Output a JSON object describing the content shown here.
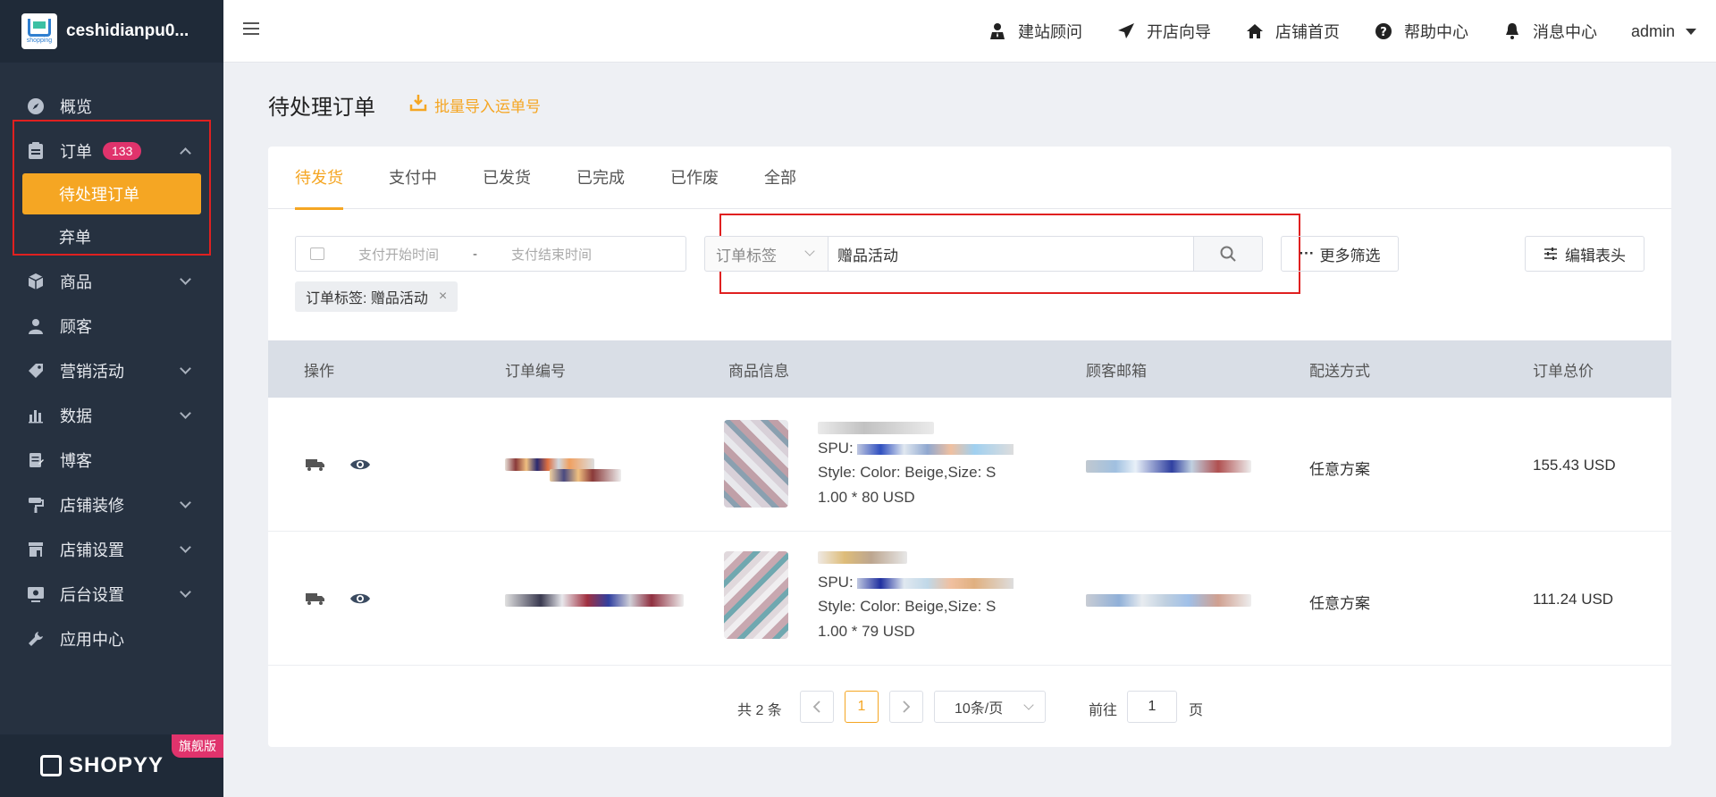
{
  "brand": {
    "name": "ceshidianpu0...",
    "logo_text": "shopping"
  },
  "sidebar": {
    "items": [
      {
        "label": "概览",
        "icon": "compass-icon"
      },
      {
        "label": "订单",
        "icon": "clipboard-icon",
        "badge": "133",
        "expanded": true,
        "children": [
          {
            "label": "待处理订单",
            "active": true
          },
          {
            "label": "弃单"
          }
        ]
      },
      {
        "label": "商品",
        "icon": "cube-icon"
      },
      {
        "label": "顾客",
        "icon": "user-icon"
      },
      {
        "label": "营销活动",
        "icon": "tag-icon"
      },
      {
        "label": "数据",
        "icon": "bar-chart-icon"
      },
      {
        "label": "博客",
        "icon": "blog-icon"
      },
      {
        "label": "店铺装修",
        "icon": "paint-roller-icon"
      },
      {
        "label": "店铺设置",
        "icon": "store-icon"
      },
      {
        "label": "后台设置",
        "icon": "admin-settings-icon"
      },
      {
        "label": "应用中心",
        "icon": "wrench-icon"
      }
    ],
    "footer": {
      "logo": "SHOPYY",
      "edition": "旗舰版"
    }
  },
  "header": {
    "nav": [
      {
        "label": "建站顾问",
        "icon": "consultant-icon"
      },
      {
        "label": "开店向导",
        "icon": "paper-plane-icon"
      },
      {
        "label": "店铺首页",
        "icon": "home-icon"
      },
      {
        "label": "帮助中心",
        "icon": "question-icon"
      },
      {
        "label": "消息中心",
        "icon": "bell-icon"
      }
    ],
    "user": "admin"
  },
  "page": {
    "title": "待处理订单",
    "import_label": "批量导入运单号"
  },
  "tabs": [
    "待发货",
    "支付中",
    "已发货",
    "已完成",
    "已作废",
    "全部"
  ],
  "filters": {
    "date_start_placeholder": "支付开始时间",
    "date_separator": "-",
    "date_end_placeholder": "支付结束时间",
    "tag_select": "订单标签",
    "search_value": "赠品活动",
    "more_filters": "更多筛选",
    "edit_header": "编辑表头",
    "active_chip": "订单标签: 赠品活动"
  },
  "table": {
    "columns": [
      "操作",
      "订单编号",
      "商品信息",
      "顾客邮箱",
      "配送方式",
      "订单总价"
    ],
    "rows": [
      {
        "order_no": "",
        "product_title": "",
        "spu": "SPU:",
        "style": "Style: Color: Beige,Size: S",
        "qty_price": "1.00 * 80 USD",
        "email": "",
        "shipping": "任意方案",
        "total": "155.43 USD"
      },
      {
        "order_no": "",
        "product_title": "",
        "spu": "SPU:",
        "style": "Style: Color: Beige,Size: S",
        "qty_price": "1.00 * 79 USD",
        "email": "",
        "shipping": "任意方案",
        "total": "111.24 USD"
      }
    ]
  },
  "pagination": {
    "total": "共 2 条",
    "current": "1",
    "page_size": "10条/页",
    "goto_label": "前往",
    "goto_value": "1",
    "unit": "页"
  },
  "colors": {
    "sidebar": "#263140",
    "accent": "#f5a623",
    "badge": "#e0336c",
    "highlight": "#e02020"
  }
}
